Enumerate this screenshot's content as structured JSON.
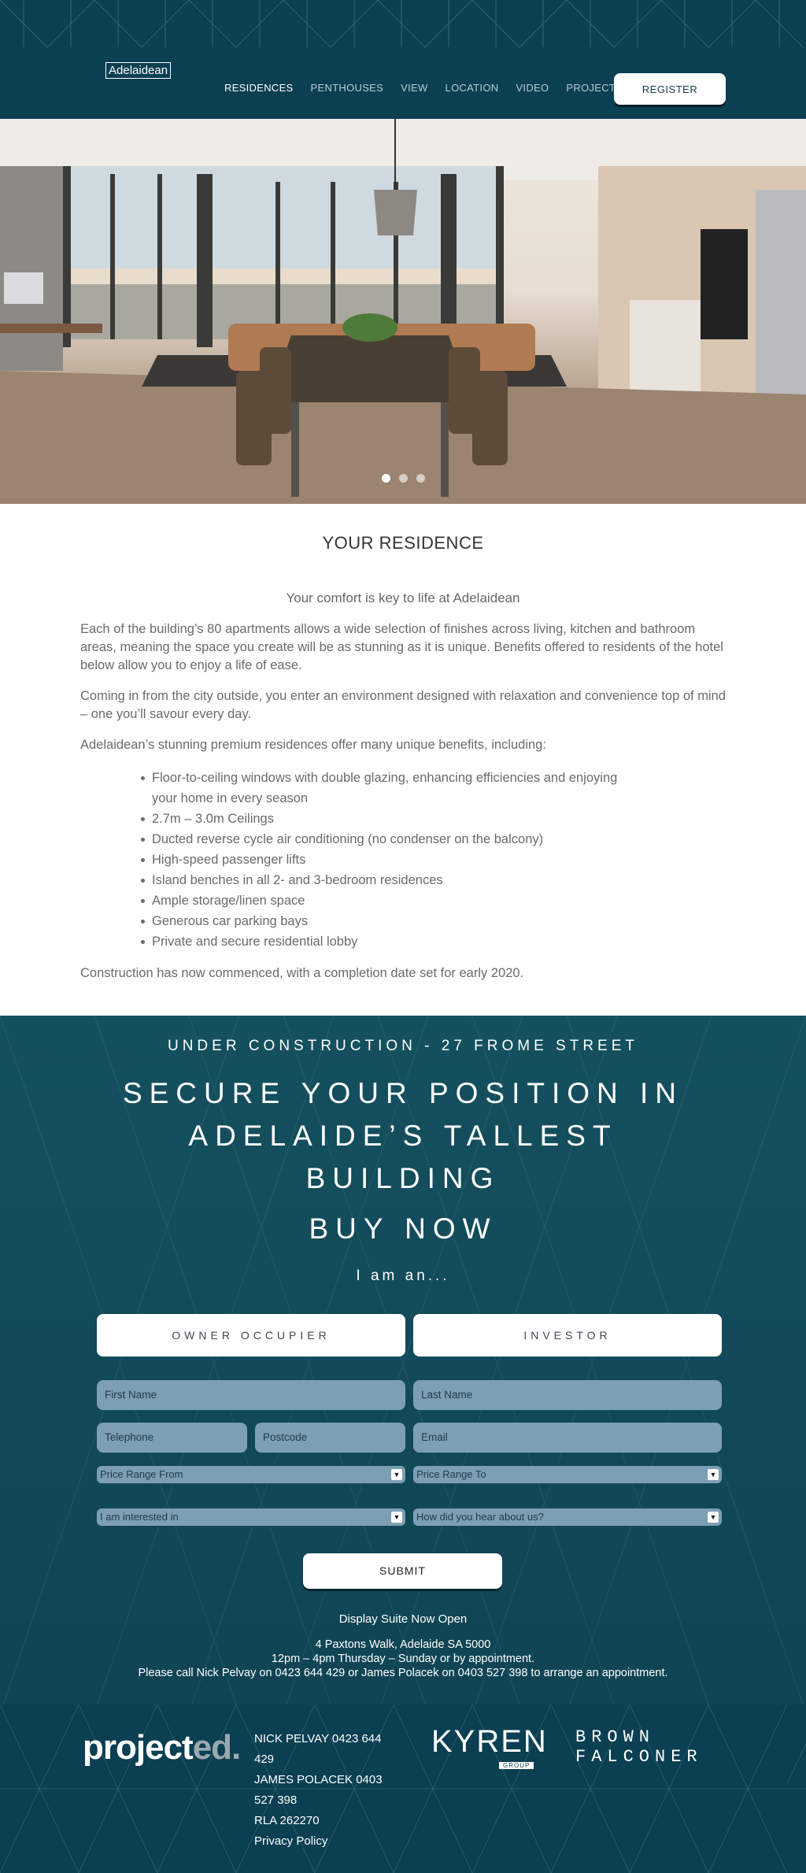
{
  "header": {
    "logo_text": "Adelaidean",
    "nav": [
      {
        "label": "RESIDENCES",
        "active": true
      },
      {
        "label": "PENTHOUSES",
        "active": false
      },
      {
        "label": "VIEW",
        "active": false
      },
      {
        "label": "LOCATION",
        "active": false
      },
      {
        "label": "VIDEO",
        "active": false
      },
      {
        "label": "PROJECT",
        "active": false
      }
    ],
    "register_label": "REGISTER"
  },
  "hero": {
    "slide_count": 3,
    "active_slide": 1
  },
  "content": {
    "title": "YOUR RESIDENCE",
    "lead": "Your comfort is key to life at Adelaidean",
    "para1": "Each of the building’s 80 apartments allows a wide selection of finishes across living, kitchen and bathroom areas, meaning the space you create will be as stunning as it is unique. Benefits offered to residents of the hotel below allow you to enjoy a life of ease.",
    "para2": "Coming in from the city outside, you enter an environment designed with relaxation and convenience top of mind – one you’ll savour every day.",
    "para3": "Adelaidean’s stunning premium residences offer many unique benefits, including:",
    "benefits": [
      "Floor-to-ceiling windows with double glazing, enhancing efficiencies and enjoying your home in every season",
      "2.7m – 3.0m Ceilings",
      "Ducted reverse cycle air conditioning (no condenser on the balcony)",
      "High-speed passenger lifts",
      "Island benches in all 2- and 3-bedroom residences",
      "Ample storage/linen space",
      "Generous car parking bays",
      "Private and secure residential lobby"
    ],
    "closing": "Construction has now commenced, with a completion date set for early 2020."
  },
  "cta": {
    "under": "UNDER CONSTRUCTION -  27 FROME STREET",
    "secure_line1": "SECURE YOUR POSITION IN",
    "secure_line2": "ADELAIDE’S TALLEST",
    "secure_line3": "BUILDING",
    "buy": "BUY NOW",
    "iam": "I am an...",
    "choice_owner": "OWNER OCCUPIER",
    "choice_investor": "INVESTOR",
    "form": {
      "first_name": "First Name",
      "last_name": "Last Name",
      "telephone": "Telephone",
      "postcode": "Postcode",
      "email": "Email",
      "price_from": "Price Range From",
      "price_to": "Price Range To",
      "interested": "I am interested in",
      "hear": "How did you hear about us?",
      "submit": "SUBMIT"
    },
    "display": "Display Suite Now Open",
    "address": "4 Paxtons Walk, Adelaide SA 5000",
    "hours": "12pm – 4pm Thursday – Sunday or by appointment.",
    "call": "Please call Nick Pelvay on 0423 644 429 or James Polacek on 0403 527 398 to arrange an appointment."
  },
  "footer": {
    "projected_main": "project",
    "projected_ed": "ed.",
    "contact_line1": "NICK PELVAY   0423 644",
    "contact_line2": "429",
    "contact_line3": "JAMES POLACEK   0403",
    "contact_line4": "527 398",
    "contact_line5": "RLA 262270",
    "privacy": "Privacy Policy",
    "kyren": "KYREN",
    "kyren_group": "GROUP",
    "brown_line1": "BROWN",
    "brown_line2": "FALCONER"
  }
}
